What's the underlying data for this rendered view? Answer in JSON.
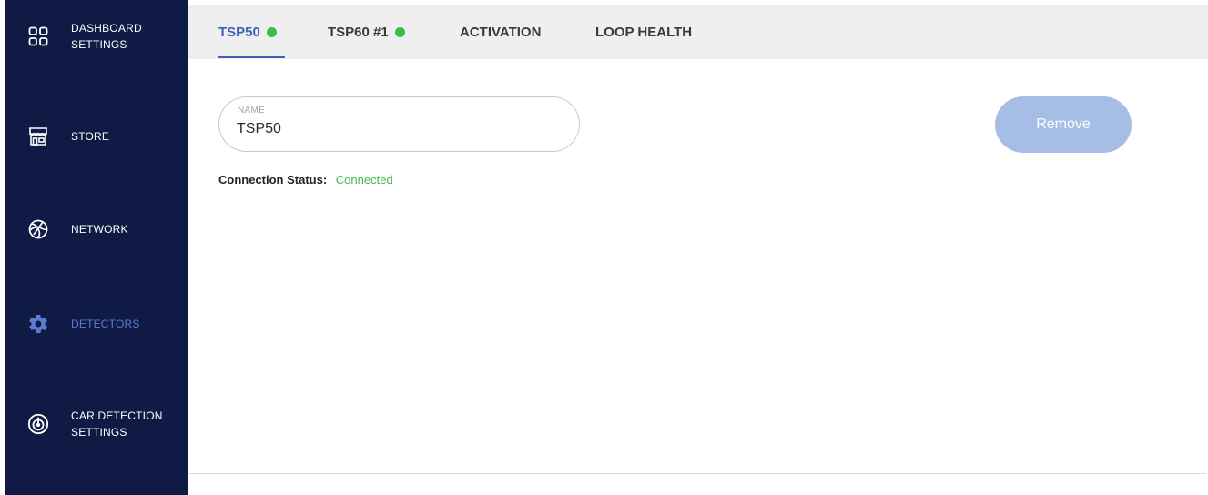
{
  "sidebar": {
    "items": [
      {
        "label_line1": "DASHBOARD",
        "label_line2": "SETTINGS",
        "icon": "grid-icon"
      },
      {
        "label_line1": "STORE",
        "label_line2": "",
        "icon": "store-icon"
      },
      {
        "label_line1": "NETWORK",
        "label_line2": "",
        "icon": "network-globe-icon"
      },
      {
        "label_line1": "DETECTORS",
        "label_line2": "",
        "icon": "gear-icon"
      },
      {
        "label_line1": "CAR DETECTION",
        "label_line2": "SETTINGS",
        "icon": "target-icon"
      }
    ],
    "active_index": 3,
    "colors": {
      "background": "#0f1b45",
      "active": "#5b7bd5"
    }
  },
  "tabs": [
    {
      "label": "TSP50",
      "status_dot": "green"
    },
    {
      "label": "TSP60 #1",
      "status_dot": "green"
    },
    {
      "label": "ACTIVATION"
    },
    {
      "label": "LOOP HEALTH"
    }
  ],
  "detector": {
    "name_label": "NAME",
    "name_value": "TSP50",
    "remove_label": "Remove",
    "status_label": "Connection Status:",
    "status_value": "Connected"
  },
  "colors": {
    "accent": "#3f62b8",
    "connected": "#3fb94b",
    "remove_button": "#a6bee5"
  }
}
